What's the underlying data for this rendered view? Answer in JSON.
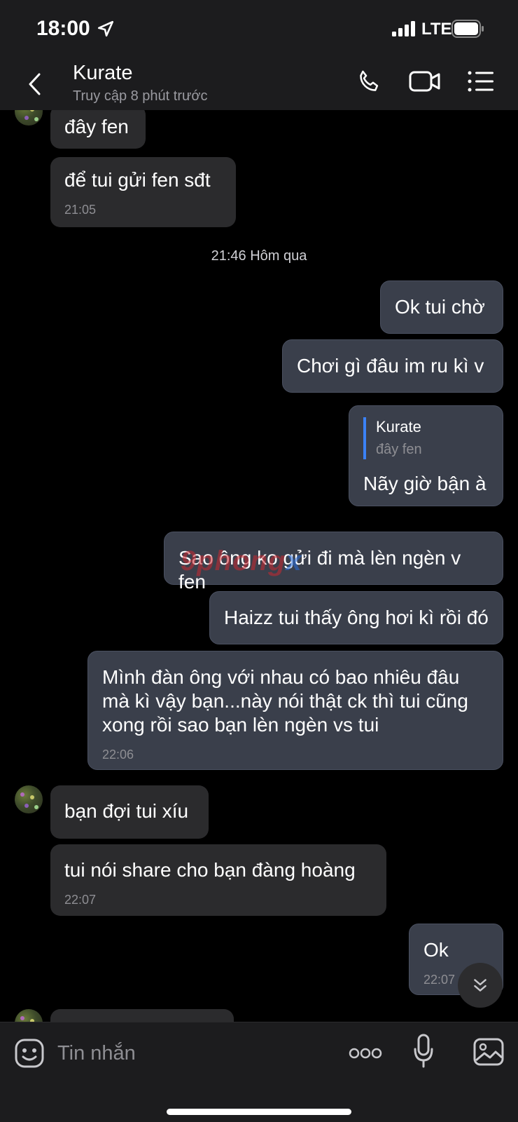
{
  "status_bar": {
    "time": "18:00",
    "network": "LTE"
  },
  "header": {
    "name": "Kurate",
    "status": "Truy cập 8 phút trước"
  },
  "messages": [
    {
      "dir": "in",
      "text": "đây fen"
    },
    {
      "dir": "in",
      "text": "để tui gửi fen sđt",
      "time": "21:05"
    },
    {
      "separator": "21:46 Hôm qua"
    },
    {
      "dir": "out",
      "text": "Ok tui chờ"
    },
    {
      "dir": "out",
      "text": "Chơi gì đâu im ru kì v"
    },
    {
      "dir": "out",
      "quote_author": "Kurate",
      "quote_text": "đây fen",
      "text": "Nãy giờ bận à"
    },
    {
      "dir": "out",
      "text": "Sao ông ko gửi đi mà lèn ngèn v fen"
    },
    {
      "dir": "out",
      "text": "Haizz tui thấy ông hơi kì rồi đó"
    },
    {
      "dir": "out",
      "text": "Mình đàn ông với nhau có bao nhiêu đâu\nmà kì vậy bạn...này nói thật ck thì tui cũng\nxong rồi sao bạn lèn ngèn vs tui",
      "time": "22:06"
    },
    {
      "dir": "in",
      "text": "bạn đợi tui xíu"
    },
    {
      "dir": "in",
      "text": "tui nói share cho bạn đàng hoàng",
      "time": "22:07"
    },
    {
      "dir": "out",
      "text": "Ok",
      "time": "22:07"
    }
  ],
  "watermark": {
    "part1": "9phong",
    "part2": "x"
  },
  "composer": {
    "placeholder": "Tin nhắn"
  },
  "colors": {
    "outgoing_bubble": "#3a3f4b",
    "incoming_bubble": "#2b2b2d",
    "quote_bar": "#3b82f6",
    "background": "#000000"
  }
}
